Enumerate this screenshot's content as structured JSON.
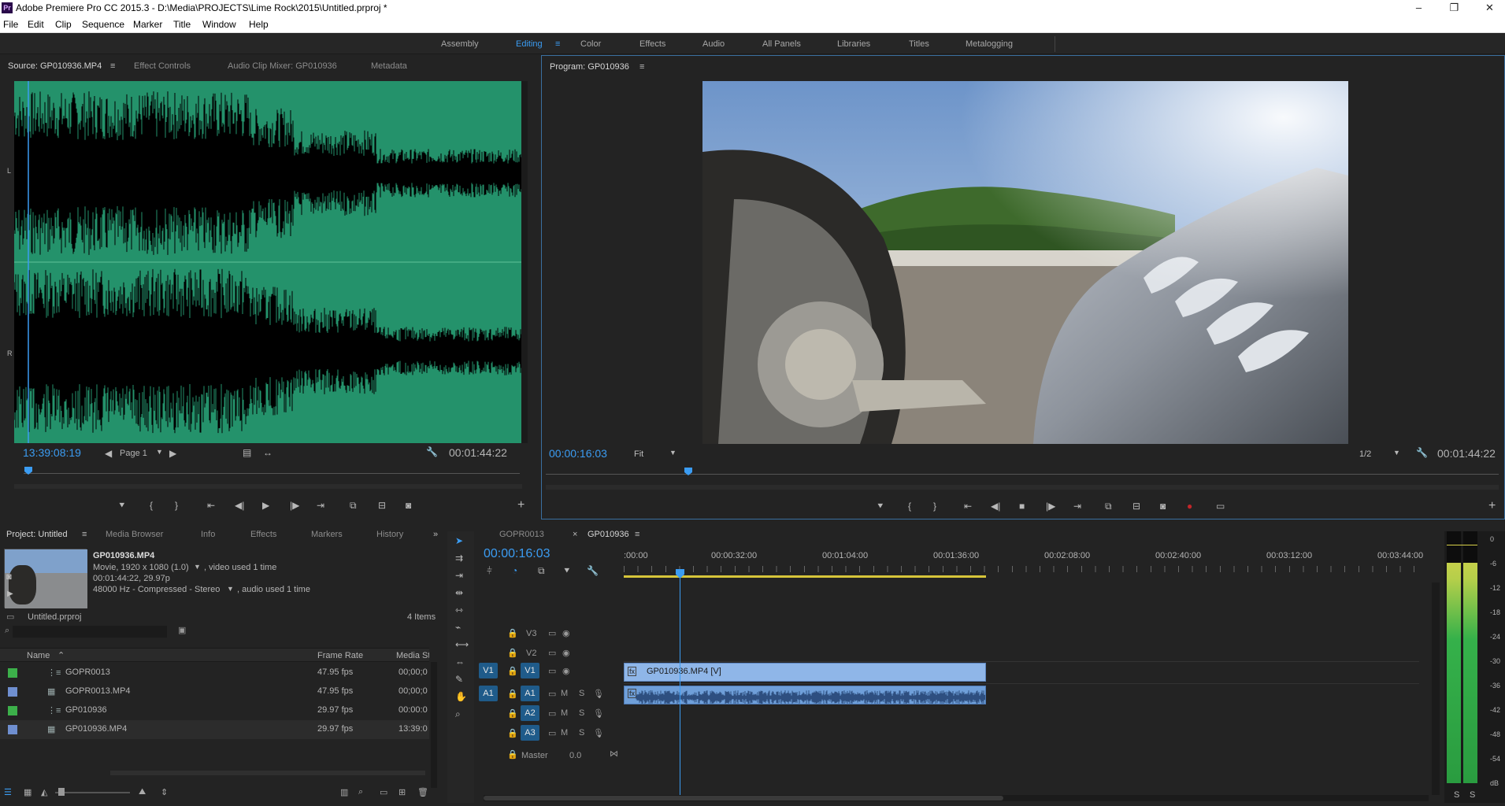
{
  "app": {
    "title": "Adobe Premiere Pro CC 2015.3 - D:\\Media\\PROJECTS\\Lime Rock\\2015\\Untitled.prproj *",
    "logo": "Pr"
  },
  "menu": [
    "File",
    "Edit",
    "Clip",
    "Sequence",
    "Marker",
    "Title",
    "Window",
    "Help"
  ],
  "workspaces": [
    "Assembly",
    "Editing",
    "Color",
    "Effects",
    "Audio",
    "All Panels",
    "Libraries",
    "Titles",
    "Metalogging"
  ],
  "workspace_active": "Editing",
  "source": {
    "tabs": [
      "Source: GP010936.MP4",
      "Effect Controls",
      "Audio Clip Mixer: GP010936",
      "Metadata"
    ],
    "channel_l": "L",
    "channel_r": "R",
    "timecode": "13:39:08:19",
    "page": "Page 1",
    "duration": "00:01:44:22"
  },
  "program": {
    "tab": "Program: GP010936",
    "timecode": "00:00:16:03",
    "fit": "Fit",
    "resolution": "1/2",
    "duration": "00:01:44:22"
  },
  "project": {
    "tabs": [
      "Project: Untitled",
      "Media Browser",
      "Info",
      "Effects",
      "Markers",
      "History"
    ],
    "clip_name": "GP010936.MP4",
    "clip_line1": "Movie, 1920 x 1080 (1.0)",
    "clip_line1_suffix": ", video used 1 time",
    "clip_line2": "00:01:44:22, 29.97p",
    "clip_line3": "48000 Hz - Compressed - Stereo",
    "clip_line3_suffix": ", audio used 1 time",
    "project_file": "Untitled.prproj",
    "items_count": "4 Items",
    "columns": [
      "Name",
      "Frame Rate",
      "Media Start"
    ],
    "rows": [
      {
        "name": "GOPR0013",
        "fps": "47.95 fps",
        "start": "00;00;0",
        "color": "#3cb04a"
      },
      {
        "name": "GOPR0013.MP4",
        "fps": "47.95 fps",
        "start": "00;00;0",
        "color": "#6f8fd0"
      },
      {
        "name": "GP010936",
        "fps": "29.97 fps",
        "start": "00:00:0",
        "color": "#3cb04a"
      },
      {
        "name": "GP010936.MP4",
        "fps": "29.97 fps",
        "start": "13:39:0",
        "color": "#6f8fd0"
      }
    ]
  },
  "timeline": {
    "tabs": [
      "GOPR0013",
      "GP010936"
    ],
    "timecode": "00:00:16:03",
    "ruler": [
      ":00:00",
      "00:00:32:00",
      "00:01:04:00",
      "00:01:36:00",
      "00:02:08:00",
      "00:02:40:00",
      "00:03:12:00",
      "00:03:44:00"
    ],
    "tracks": {
      "v3": "V3",
      "v2": "V2",
      "v1": "V1",
      "a1": "A1",
      "a2": "A2",
      "a3": "A3",
      "src_v1": "V1",
      "src_a1": "A1",
      "master": "Master",
      "master_val": "0.0",
      "m": "M",
      "s": "S"
    },
    "video_clip": "GP010936.MP4 [V]",
    "fx_badge": "fx"
  },
  "meter": {
    "scale": [
      "0",
      "-6",
      "-12",
      "-18",
      "-24",
      "-30",
      "-36",
      "-42",
      "-48",
      "-54",
      "dB"
    ],
    "solo_l": "S",
    "solo_r": "S"
  },
  "colors": {
    "accent": "#3b9cf2",
    "waveform": "#24926b",
    "clip_video": "#8fb6e8",
    "clip_audio": "#6f9fd9"
  }
}
